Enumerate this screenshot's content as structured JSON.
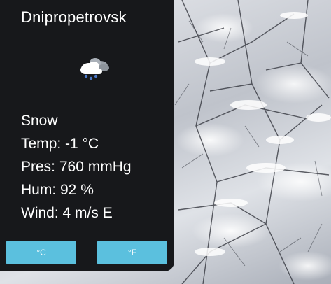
{
  "weather": {
    "city": "Dnipropetrovsk",
    "condition": "Snow",
    "temp_label": "Temp: -1 °C",
    "pressure_label": "Pres: 760 mmHg",
    "humidity_label": "Hum: 92 %",
    "wind_label": "Wind: 4 m/s E",
    "icon": "snow-cloud-icon"
  },
  "units": {
    "celsius_label": "°C",
    "fahrenheit_label": "°F"
  },
  "colors": {
    "panel_bg": "#17181b",
    "button_bg": "#5bc0de",
    "text": "#ffffff"
  }
}
